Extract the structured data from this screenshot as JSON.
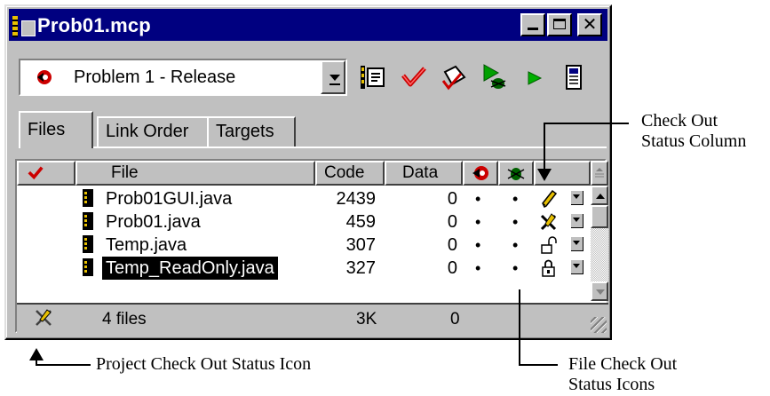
{
  "window": {
    "title": "Prob01.mcp"
  },
  "target": {
    "selected": "Problem 1 - Release"
  },
  "toolbar": {
    "icons": [
      "settings-icon",
      "check-syntax-icon",
      "bring-up-to-date-icon",
      "debug-icon",
      "run-icon",
      "project-inspector-icon"
    ]
  },
  "tabs": [
    {
      "label": "Files",
      "active": true
    },
    {
      "label": "Link Order",
      "active": false
    },
    {
      "label": "Targets",
      "active": false
    }
  ],
  "columns": {
    "file": "File",
    "code": "Code",
    "data": "Data"
  },
  "files": [
    {
      "name": "Prob01GUI.java",
      "code": "2439",
      "data": "0",
      "status": "checked-out-pencil",
      "selected": false
    },
    {
      "name": "Prob01.java",
      "code": "459",
      "data": "0",
      "status": "not-checked-out-x",
      "selected": false
    },
    {
      "name": "Temp.java",
      "code": "307",
      "data": "0",
      "status": "unlocked",
      "selected": false
    },
    {
      "name": "Temp_ReadOnly.java",
      "code": "327",
      "data": "0",
      "status": "locked",
      "selected": true
    }
  ],
  "dot": "•",
  "footer": {
    "count": "4 files",
    "code": "3K",
    "data": "0"
  },
  "annotations": {
    "check_out_column": [
      "Check Out",
      "Status Column"
    ],
    "project_icon": "Project Check Out Status Icon",
    "file_icons": [
      "File Check Out",
      "Status Icons"
    ]
  },
  "colors": {
    "titlebar": "#000080",
    "face": "#c0c0c0",
    "selection": "#000000",
    "check_red": "#cc0000",
    "run_green": "#00a000"
  }
}
